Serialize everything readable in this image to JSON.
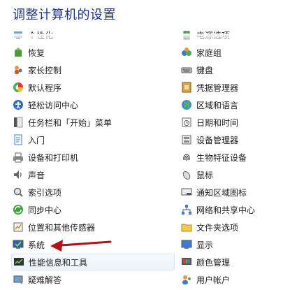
{
  "window": {
    "title": "调整计算机的设置"
  },
  "left_items": [
    {
      "label": "个性化",
      "icon": "personalization-icon"
    },
    {
      "label": "恢复",
      "icon": "recovery-icon"
    },
    {
      "label": "家长控制",
      "icon": "parental-controls-icon"
    },
    {
      "label": "默认程序",
      "icon": "default-programs-icon"
    },
    {
      "label": "轻松访问中心",
      "icon": "ease-of-access-icon"
    },
    {
      "label": "任务栏和「开始」菜单",
      "icon": "taskbar-icon"
    },
    {
      "label": "入门",
      "icon": "getting-started-icon"
    },
    {
      "label": "设备和打印机",
      "icon": "printer-icon"
    },
    {
      "label": "声音",
      "icon": "speaker-icon"
    },
    {
      "label": "索引选项",
      "icon": "indexing-icon"
    },
    {
      "label": "同步中心",
      "icon": "sync-icon"
    },
    {
      "label": "位置和其他传感器",
      "icon": "sensor-icon"
    },
    {
      "label": "系统",
      "icon": "system-icon"
    },
    {
      "label": "性能信息和工具",
      "icon": "performance-icon"
    },
    {
      "label": "疑难解答",
      "icon": "troubleshooting-icon"
    }
  ],
  "right_items": [
    {
      "label": "电源选项",
      "icon": "power-icon"
    },
    {
      "label": "家庭组",
      "icon": "homegroup-icon"
    },
    {
      "label": "键盘",
      "icon": "keyboard-icon"
    },
    {
      "label": "凭据管理器",
      "icon": "credential-icon"
    },
    {
      "label": "区域和语言",
      "icon": "globe-icon"
    },
    {
      "label": "日期和时间",
      "icon": "clock-icon"
    },
    {
      "label": "设备管理器",
      "icon": "device-manager-icon"
    },
    {
      "label": "生物特征设备",
      "icon": "fingerprint-icon"
    },
    {
      "label": "鼠标",
      "icon": "mouse-icon"
    },
    {
      "label": "通知区域图标",
      "icon": "notification-icon"
    },
    {
      "label": "网络和共享中心",
      "icon": "network-icon"
    },
    {
      "label": "文件夹选项",
      "icon": "folder-icon"
    },
    {
      "label": "显示",
      "icon": "display-icon"
    },
    {
      "label": "颜色管理",
      "icon": "color-icon"
    },
    {
      "label": "用户帐户",
      "icon": "user-accounts-icon"
    }
  ],
  "highlight_label": "性能信息和工具",
  "arrow_color": "#b4121b"
}
